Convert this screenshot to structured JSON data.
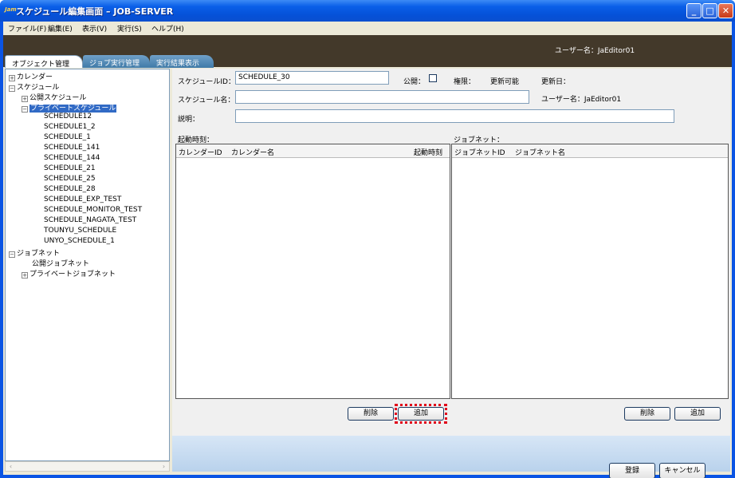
{
  "window": {
    "icon_text": "Jam",
    "title": "スケジュール編集画面 – JOB-SERVER"
  },
  "menu": [
    "ファイル(F)",
    "編集(E)",
    "表示(V)",
    "実行(S)",
    "ヘルプ(H)"
  ],
  "header": {
    "user_label": "ユーザー名：JaEditor01"
  },
  "tabs": [
    "オブジェクト管理",
    "ジョブ実行管理",
    "実行結果表示"
  ],
  "tree": {
    "calendar": "カレンダー",
    "schedule": "スケジュール",
    "public_schedule": "公開スケジュール",
    "private_schedule": "プライベートスケジュール",
    "schedules": [
      "SCHEDULE12",
      "SCHEDULE1_2",
      "SCHEDULE_1",
      "SCHEDULE_141",
      "SCHEDULE_144",
      "SCHEDULE_21",
      "SCHEDULE_25",
      "SCHEDULE_28",
      "SCHEDULE_EXP_TEST",
      "SCHEDULE_MONITOR_TEST",
      "SCHEDULE_NAGATA_TEST",
      "TOUNYU_SCHEDULE",
      "UNYO_SCHEDULE_1"
    ],
    "jobnet": "ジョブネット",
    "public_jobnet": "公開ジョブネット",
    "private_jobnet": "プライベートジョブネット"
  },
  "form": {
    "schedule_id_label": "スケジュールID：",
    "schedule_id_value": "SCHEDULE_30",
    "public_label": "公開：",
    "authority_label": "権限：",
    "authority_value": "更新可能",
    "updated_label": "更新日：",
    "schedule_name_label": "スケジュール名：",
    "user_label": "ユーザー名：JaEditor01",
    "description_label": "説明："
  },
  "start_time": {
    "section_label": "起動時刻：",
    "columns": [
      "カレンダーID",
      "カレンダー名",
      "起動時刻"
    ],
    "delete_label": "削除",
    "add_label": "追加"
  },
  "jobnet": {
    "section_label": "ジョブネット：",
    "columns": [
      "ジョブネットID",
      "ジョブネット名"
    ],
    "delete_label": "削除",
    "add_label": "追加"
  },
  "footer": {
    "register_label": "登録",
    "cancel_label": "キャンセル"
  }
}
